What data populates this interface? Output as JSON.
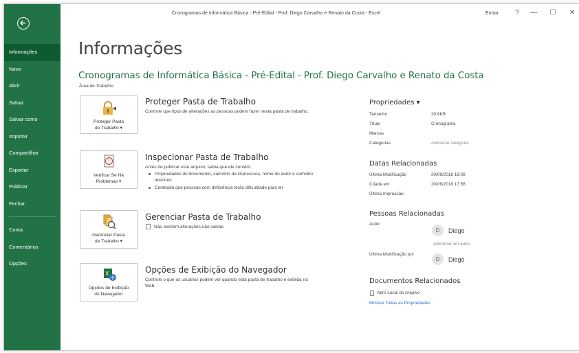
{
  "window": {
    "title": "Cronogramas de Informática Básica - Pré-Edital - Prof. Diego Carvalho e Renato da Costa  -  Excel",
    "signin": "Entrar",
    "help": "?",
    "minimize": "—",
    "maximize": "☐",
    "close": "✕"
  },
  "sidebar": {
    "items": [
      {
        "label": "Informações"
      },
      {
        "label": "Novo"
      },
      {
        "label": "Abrir"
      },
      {
        "label": "Salvar"
      },
      {
        "label": "Salvar como"
      },
      {
        "label": "Imprimir"
      },
      {
        "label": "Compartilhar"
      },
      {
        "label": "Exportar"
      },
      {
        "label": "Publicar"
      },
      {
        "label": "Fechar"
      },
      {
        "label": "Conta"
      },
      {
        "label": "Comentários"
      },
      {
        "label": "Opções"
      }
    ]
  },
  "main": {
    "title": "Informações",
    "doc_title": "Cronogramas de Informática Básica - Pré-Edital - Prof. Diego Carvalho e Renato da Costa",
    "doc_location": "Área de Trabalho",
    "sections": [
      {
        "button_line1": "Proteger Pasta",
        "button_line2": "de Trabalho ▾",
        "heading": "Proteger Pasta de Trabalho",
        "description": "Controle que tipos de alterações as pessoas podem fazer nesta pasta de trabalho."
      },
      {
        "button_line1": "Verificar Se Há",
        "button_line2": "Problemas ▾",
        "heading": "Inspecionar Pasta de Trabalho",
        "description": "Antes de publicar este arquivo, saiba que ele contém:",
        "bullets": [
          "Propriedades do documento, caminho da impressora, nome do autor e caminho absoluto",
          "Conteúdo que pessoas com deficiência terão dificuldade para ler"
        ]
      },
      {
        "button_line1": "Gerenciar Pasta",
        "button_line2": "de Trabalho ▾",
        "heading": "Gerenciar Pasta de Trabalho",
        "description": "Não existem alterações não salvas."
      },
      {
        "button_line1": "Opções de Exibição",
        "button_line2": "do Navegador",
        "heading": "Opções de Exibição do Navegador",
        "description": "Controle o que os usuários podem ver quando esta pasta de trabalho é exibida na Web."
      }
    ]
  },
  "properties": {
    "heading": "Propriedades ▾",
    "rows": [
      {
        "label": "Tamanho",
        "value": "20,6KB"
      },
      {
        "label": "Título",
        "value": "Cronograma"
      },
      {
        "label": "Marcas",
        "value": ""
      },
      {
        "label": "Categorias",
        "value": "Adicionar categoria"
      }
    ],
    "dates_heading": "Datas Relacionadas",
    "dates": [
      {
        "label": "Última Modificação",
        "value": "20/09/2018 18:08"
      },
      {
        "label": "Criada em",
        "value": "20/09/2018 17:56"
      },
      {
        "label": "Última Impressão",
        "value": ""
      }
    ],
    "people_heading": "Pessoas Relacionadas",
    "author_label": "Autor",
    "author_initial": "D",
    "author_name": "Diego",
    "add_author": "Adicionar um autor",
    "modified_by_label": "Última Modificação por",
    "modified_by_initial": "D",
    "modified_by_name": "Diego",
    "docs_heading": "Documentos Relacionados",
    "open_location": "Abrir Local do Arquivo",
    "show_all": "Mostrar Todas as Propriedades"
  },
  "colors": {
    "accent": "#217346",
    "active_nav": "#0e5b31",
    "link": "#2a6fbf"
  }
}
